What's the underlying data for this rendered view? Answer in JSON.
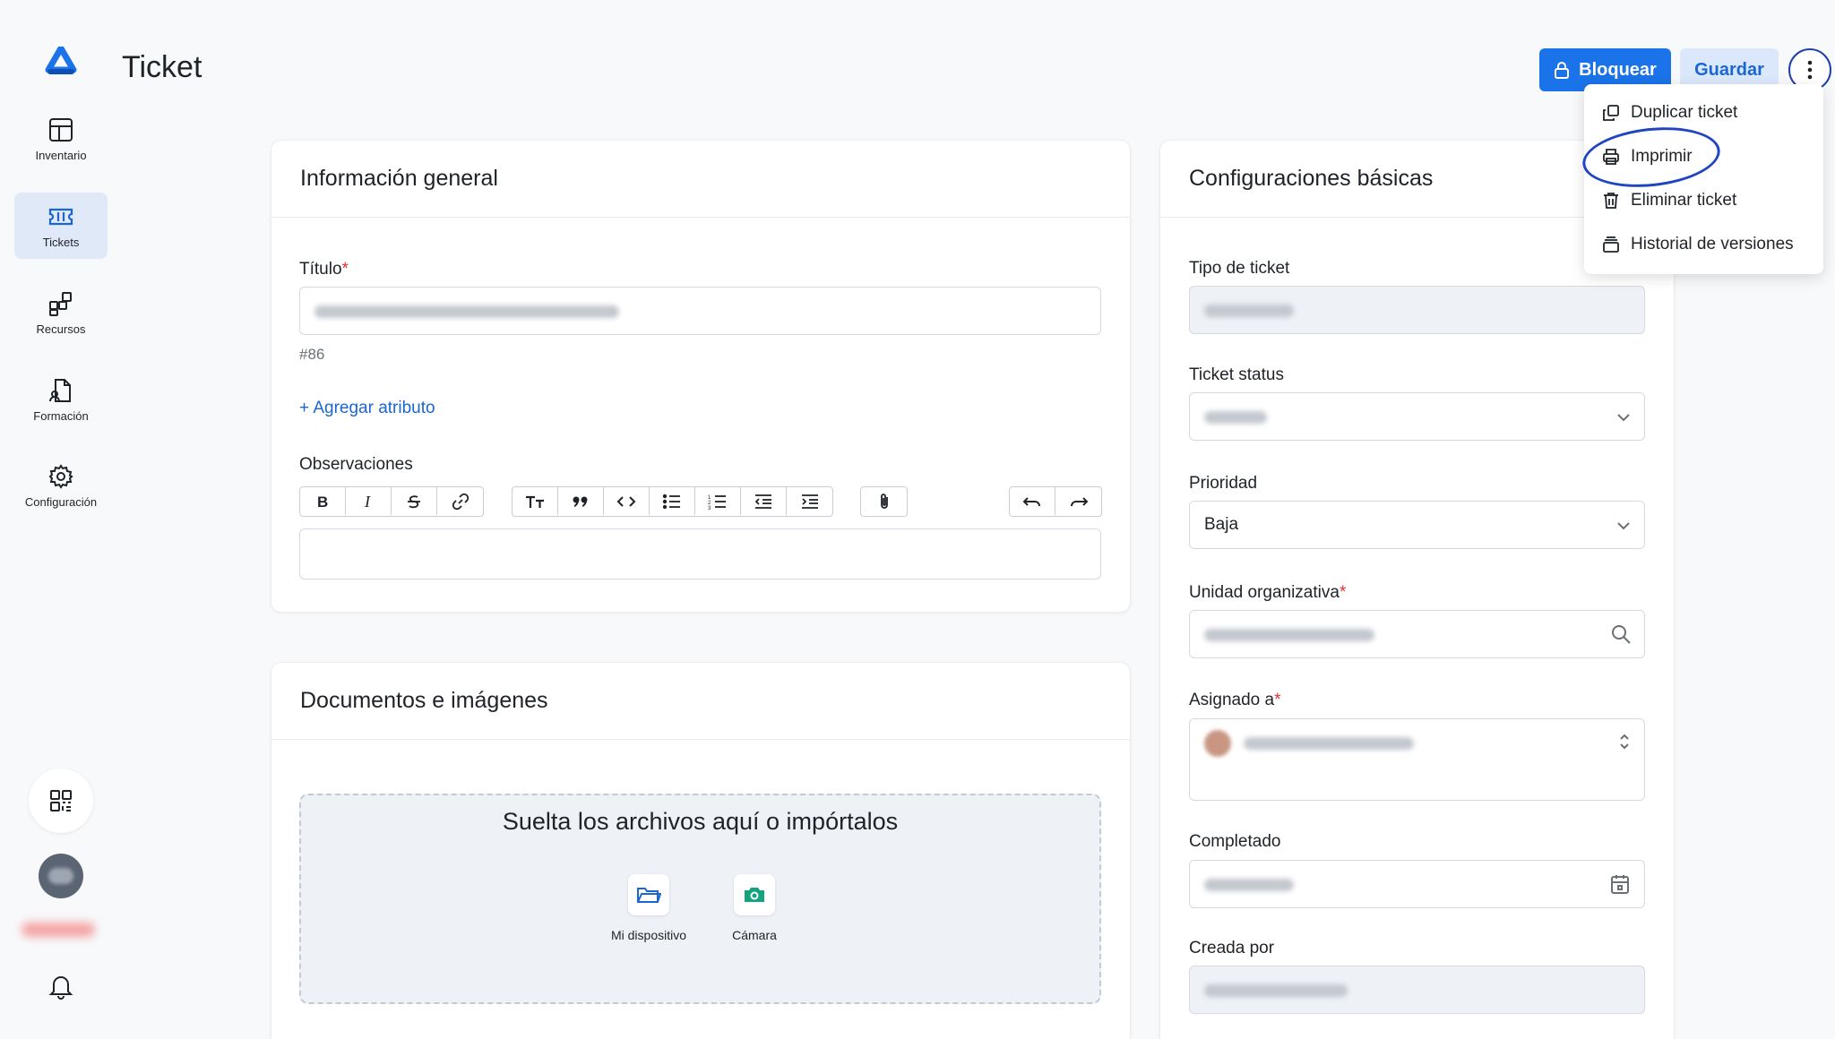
{
  "page": {
    "title": "Ticket"
  },
  "colors": {
    "primary": "#1a73e8",
    "secondary_bg": "#dbe8fb",
    "required": "#e0322f",
    "active_nav_bg": "#dfe9f8"
  },
  "sidebar": {
    "items": [
      {
        "label": "Inventario",
        "icon": "inventory-icon"
      },
      {
        "label": "Tickets",
        "icon": "ticket-icon",
        "active": true
      },
      {
        "label": "Recursos",
        "icon": "resources-icon"
      },
      {
        "label": "Formación",
        "icon": "training-icon"
      },
      {
        "label": "Configuración",
        "icon": "gear-icon"
      }
    ]
  },
  "header": {
    "lock_label": "Bloquear",
    "save_label": "Guardar"
  },
  "menu": {
    "items": [
      {
        "label": "Duplicar ticket",
        "icon": "duplicate-icon"
      },
      {
        "label": "Imprimir",
        "icon": "printer-icon"
      },
      {
        "label": "Eliminar ticket",
        "icon": "trash-icon"
      },
      {
        "label": "Historial de versiones",
        "icon": "history-icon"
      }
    ]
  },
  "general": {
    "heading": "Información general",
    "title_label": "Título",
    "required_mark": "*",
    "ticket_number": "#86",
    "add_attribute": "+ Agregar atributo",
    "notes_label": "Observaciones"
  },
  "documents": {
    "heading": "Documentos e imágenes",
    "drop_text": "Suelta los archivos aquí o impórtalos",
    "device_label": "Mi dispositivo",
    "camera_label": "Cámara"
  },
  "config": {
    "heading": "Configuraciones básicas",
    "type_label": "Tipo de ticket",
    "status_label": "Ticket status",
    "priority_label": "Prioridad",
    "priority_value": "Baja",
    "unit_label": "Unidad organizativa",
    "assigned_label": "Asignado a",
    "completed_label": "Completado",
    "created_label": "Creada por"
  }
}
